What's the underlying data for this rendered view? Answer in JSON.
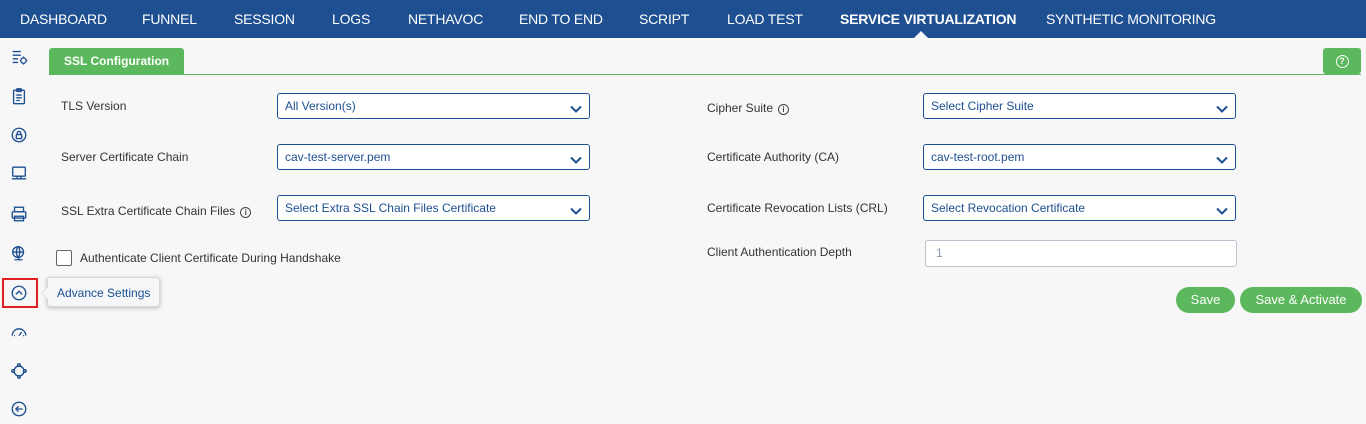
{
  "nav": {
    "items": [
      {
        "label": "DASHBOARD"
      },
      {
        "label": "FUNNEL"
      },
      {
        "label": "SESSION"
      },
      {
        "label": "LOGS"
      },
      {
        "label": "NETHAVOC"
      },
      {
        "label": "END TO END"
      },
      {
        "label": "SCRIPT"
      },
      {
        "label": "LOAD TEST"
      },
      {
        "label": "SERVICE VIRTUALIZATION"
      },
      {
        "label": "SYNTHETIC MONITORING"
      }
    ],
    "active": "SERVICE VIRTUALIZATION"
  },
  "sidebar": {
    "icons": [
      "list-settings-icon",
      "clipboard-icon",
      "lock-icon",
      "monitor-icon",
      "ssl-printer-icon",
      "globe-icon",
      "advance-settings-icon",
      "speedometer-icon",
      "network-icon",
      "back-arrow-icon"
    ],
    "tooltip": "Advance Settings"
  },
  "tab": {
    "label": "SSL Configuration"
  },
  "help": {
    "icon": "help-icon",
    "glyph": "?"
  },
  "form": {
    "tls_version": {
      "label": "TLS Version",
      "value": "All Version(s)"
    },
    "cipher_suite": {
      "label": "Cipher Suite",
      "value": "Select Cipher Suite"
    },
    "server_cert_chain": {
      "label": "Server Certificate Chain",
      "value": "cav-test-server.pem"
    },
    "ca": {
      "label": "Certificate Authority (CA)",
      "value": "cav-test-root.pem"
    },
    "ssl_extra_chain": {
      "label": "SSL Extra Certificate Chain Files",
      "value": "Select Extra SSL Chain Files Certificate"
    },
    "crl": {
      "label": "Certificate Revocation Lists (CRL)",
      "value": "Select Revocation Certificate"
    },
    "auth_client_cert": {
      "label": "Authenticate Client Certificate During Handshake",
      "checked": false
    },
    "client_auth_depth": {
      "label": "Client Authentication Depth",
      "placeholder": "1"
    }
  },
  "info_glyph": "i",
  "buttons": {
    "save": "Save",
    "save_activate": "Save & Activate"
  },
  "colors": {
    "nav_bg": "#1d4f91",
    "accent_green": "#5cb85c",
    "highlight_red": "#e02020"
  }
}
